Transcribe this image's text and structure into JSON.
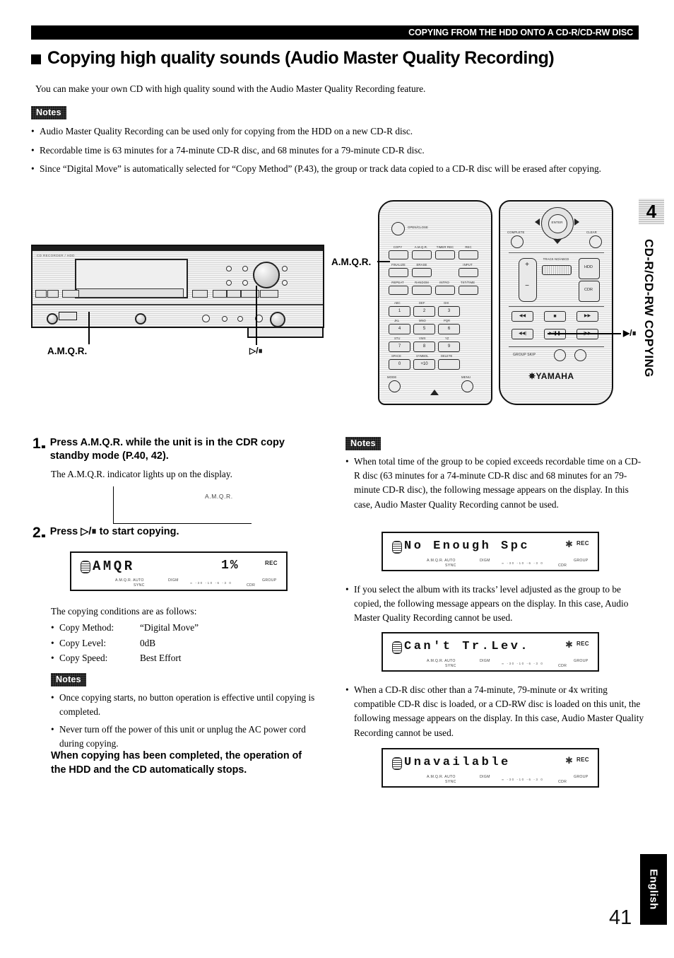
{
  "header": {
    "band_text": "COPYING FROM THE HDD ONTO A CD-R/CD-RW DISC"
  },
  "section": {
    "title": "Copying high quality sounds (Audio Master Quality Recording)",
    "intro": "You can make your own CD with high quality sound with the Audio Master Quality Recording feature."
  },
  "notes_label": "Notes",
  "top_notes": [
    "Audio Master Quality Recording can be used only for copying from the HDD on a new CD-R disc.",
    "Recordable time is 63 minutes for a 74-minute CD-R disc, and 68 minutes for a 79-minute CD-R disc.",
    "Since “Digital Move” is automatically selected for “Copy Method” (P.43), the group or track data copied to a CD-R disc will be erased after copying."
  ],
  "figure": {
    "deck_callout_left": "A.M.Q.R.",
    "deck_callout_right": "▷/⏸",
    "remote_callout_left": "A.M.Q.R.",
    "remote_callout_right": "▶/⏸",
    "deck_brand": "CD RECORDER / HDD"
  },
  "remote_left": {
    "open_close": "OPEN/CLOSE",
    "row1": [
      "COPY",
      "A.M.Q.R.",
      "TIMER REC",
      "REC"
    ],
    "row2": [
      "FINALIZE",
      "ERASE",
      "INPUT"
    ],
    "row3": [
      "REPEAT",
      "RANDOM",
      "INTRO",
      "TXT/TIME"
    ],
    "keypad": [
      {
        "letters": "ABC",
        "digit": "1"
      },
      {
        "letters": "DEF",
        "digit": "2"
      },
      {
        "letters": "GHI",
        "digit": "3"
      },
      {
        "letters": "JKL",
        "digit": "4"
      },
      {
        "letters": "MNO",
        "digit": "5"
      },
      {
        "letters": "PQR",
        "digit": "6"
      },
      {
        "letters": "STU",
        "digit": "7"
      },
      {
        "letters": "VWX",
        "digit": "8"
      },
      {
        "letters": "YZ",
        "digit": "9"
      },
      {
        "letters": "SPACE",
        "digit": "0"
      },
      {
        "letters": "SYMBOL",
        "digit": "+10"
      },
      {
        "letters": "DELETE",
        "digit": ""
      }
    ],
    "mode": "MODE",
    "menu": "MENU"
  },
  "remote_right": {
    "enter": "ENTER",
    "complete": "COMPLETE",
    "clear": "CLEAR",
    "plus": "+",
    "minus": "−",
    "track_no": "TRACK NO/ABCD",
    "hdd": "HDD",
    "cdr": "CDR",
    "group_skip": "GROUP SKIP",
    "brand": "✵YAMAHA"
  },
  "chapter": {
    "number": "4",
    "vertical_title": "CD-R/CD-RW COPYING"
  },
  "steps": [
    {
      "number": "1",
      "head": "Press A.M.Q.R. while the unit is in the CDR copy standby mode (P.40, 42).",
      "sub": "The A.M.Q.R. indicator lights up on the display.",
      "indicator_text": "A.M.Q.R."
    },
    {
      "number": "2",
      "head": "Press ▷/⏸ to start copying."
    }
  ],
  "lcd_copying": {
    "main": "AMQR",
    "percent": "1%",
    "rec": "REC",
    "sub_left": "A.M.Q.R. AUTO",
    "sub_sync": "SYNC",
    "sub_digm": "DIGM",
    "meter": "∞ -30 -10 -6 -3 0",
    "sub_cdr": "CDR",
    "sub_group": "GROUP"
  },
  "conditions": {
    "title": "The copying conditions are as follows:",
    "rows": [
      {
        "key": "Copy Method:",
        "value": "“Digital Move”"
      },
      {
        "key": "Copy Level:",
        "value": "0dB"
      },
      {
        "key": "Copy Speed:",
        "value": "Best Effort"
      }
    ]
  },
  "left_notes": [
    "Once copying starts, no button operation is effective until copying is completed.",
    "Never turn off the power of this unit or unplug the AC power cord during copying."
  ],
  "bold_statement": "When copying has been completed, the operation of the HDD and the CD automatically stops.",
  "right_notes": [
    "When total time of the group to be copied exceeds recordable time on a CD-R disc (63 minutes for a 74-minute CD-R disc and 68 minutes for an 79-minute CD-R disc), the following message appears on the display. In this case, Audio Master Quality Recording cannot be used.",
    "If you select the album with its tracks’ level adjusted as the group to be copied, the following message appears on the display. In this case, Audio Master Quality Recording cannot be used.",
    "When a CD-R disc other than a 74-minute, 79-minute or 4x writing compatible CD-R disc is loaded, or a CD-RW disc is loaded on this unit, the following message appears on the display. In this case, Audio Master Quality Recording cannot be used."
  ],
  "lcd_error_1": {
    "main": "No Enough Spc",
    "rec": "REC",
    "sub_left": "A.M.Q.R. AUTO",
    "sub_sync": "SYNC",
    "sub_digm": "DIGM",
    "meter": "∞ -30 -10 -6 -3 0",
    "sub_cdr": "CDR",
    "sub_group": "GROUP"
  },
  "lcd_error_2": {
    "main": "Can't Tr.Lev.",
    "rec": "REC",
    "sub_left": "A.M.Q.R. AUTO",
    "sub_sync": "SYNC",
    "sub_digm": "DIGM",
    "meter": "∞ -30 -10 -6 -3 0",
    "sub_cdr": "CDR",
    "sub_group": "GROUP"
  },
  "lcd_error_3": {
    "main": "Unavailable",
    "rec": "REC",
    "sub_left": "A.M.Q.R. AUTO",
    "sub_sync": "SYNC",
    "sub_digm": "DIGM",
    "meter": "∞ -30 -10 -6 -3 0",
    "sub_cdr": "CDR",
    "sub_group": "GROUP"
  },
  "footer": {
    "language": "English",
    "page_number": "41"
  }
}
